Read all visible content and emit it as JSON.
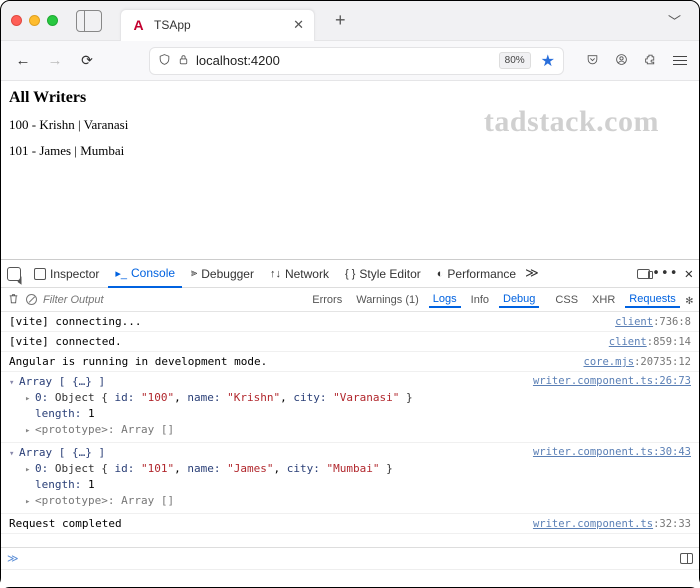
{
  "tab": {
    "title": "TSApp",
    "favicon_letter": "A"
  },
  "address": {
    "host": "localhost",
    "port": ":4200",
    "zoom": "80%"
  },
  "watermark": "tadstack.com",
  "page": {
    "heading": "All Writers",
    "writers": [
      {
        "line": "100 - Krishn | Varanasi"
      },
      {
        "line": "101 - James | Mumbai"
      }
    ]
  },
  "devtools": {
    "tabs": {
      "inspector": "Inspector",
      "console": "Console",
      "debugger": "Debugger",
      "network": "Network",
      "style": "Style Editor",
      "perf": "Performance"
    },
    "filter_placeholder": "Filter Output",
    "filter_cats": {
      "errors": "Errors",
      "warnings": "Warnings (1)",
      "logs": "Logs",
      "info": "Info",
      "debug": "Debug",
      "css": "CSS",
      "xhr": "XHR",
      "requests": "Requests"
    },
    "logs": [
      {
        "msg": "[vite] connecting...",
        "src_file": "client",
        "src_loc": "736:8"
      },
      {
        "msg": "[vite] connected.",
        "src_file": "client",
        "src_loc": "859:14"
      },
      {
        "msg": "Angular is running in development mode.",
        "src_file": "core.mjs",
        "src_loc": "20735:12"
      }
    ],
    "arrays": [
      {
        "src_file": "writer.component.ts",
        "src_loc": "26:73",
        "head": "Array [ {…} ]",
        "idx": "0:",
        "obj_prefix": "Object { ",
        "k_id": "id:",
        "v_id": "\"100\"",
        "k_name": "name:",
        "v_name": "\"Krishn\"",
        "k_city": "city:",
        "v_city": "\"Varanasi\"",
        "obj_suffix": " }",
        "length_label": "length:",
        "length_val": "1",
        "proto": "<prototype>: Array []"
      },
      {
        "src_file": "writer.component.ts",
        "src_loc": "30:43",
        "head": "Array [ {…} ]",
        "idx": "0:",
        "obj_prefix": "Object { ",
        "k_id": "id:",
        "v_id": "\"101\"",
        "k_name": "name:",
        "v_name": "\"James\"",
        "k_city": "city:",
        "v_city": "\"Mumbai\"",
        "obj_suffix": " }",
        "length_label": "length:",
        "length_val": "1",
        "proto": "<prototype>: Array []"
      }
    ],
    "final_log": {
      "msg": "Request completed",
      "src_file": "writer.component.ts",
      "src_loc": "32:33"
    },
    "prompt": "≫"
  }
}
